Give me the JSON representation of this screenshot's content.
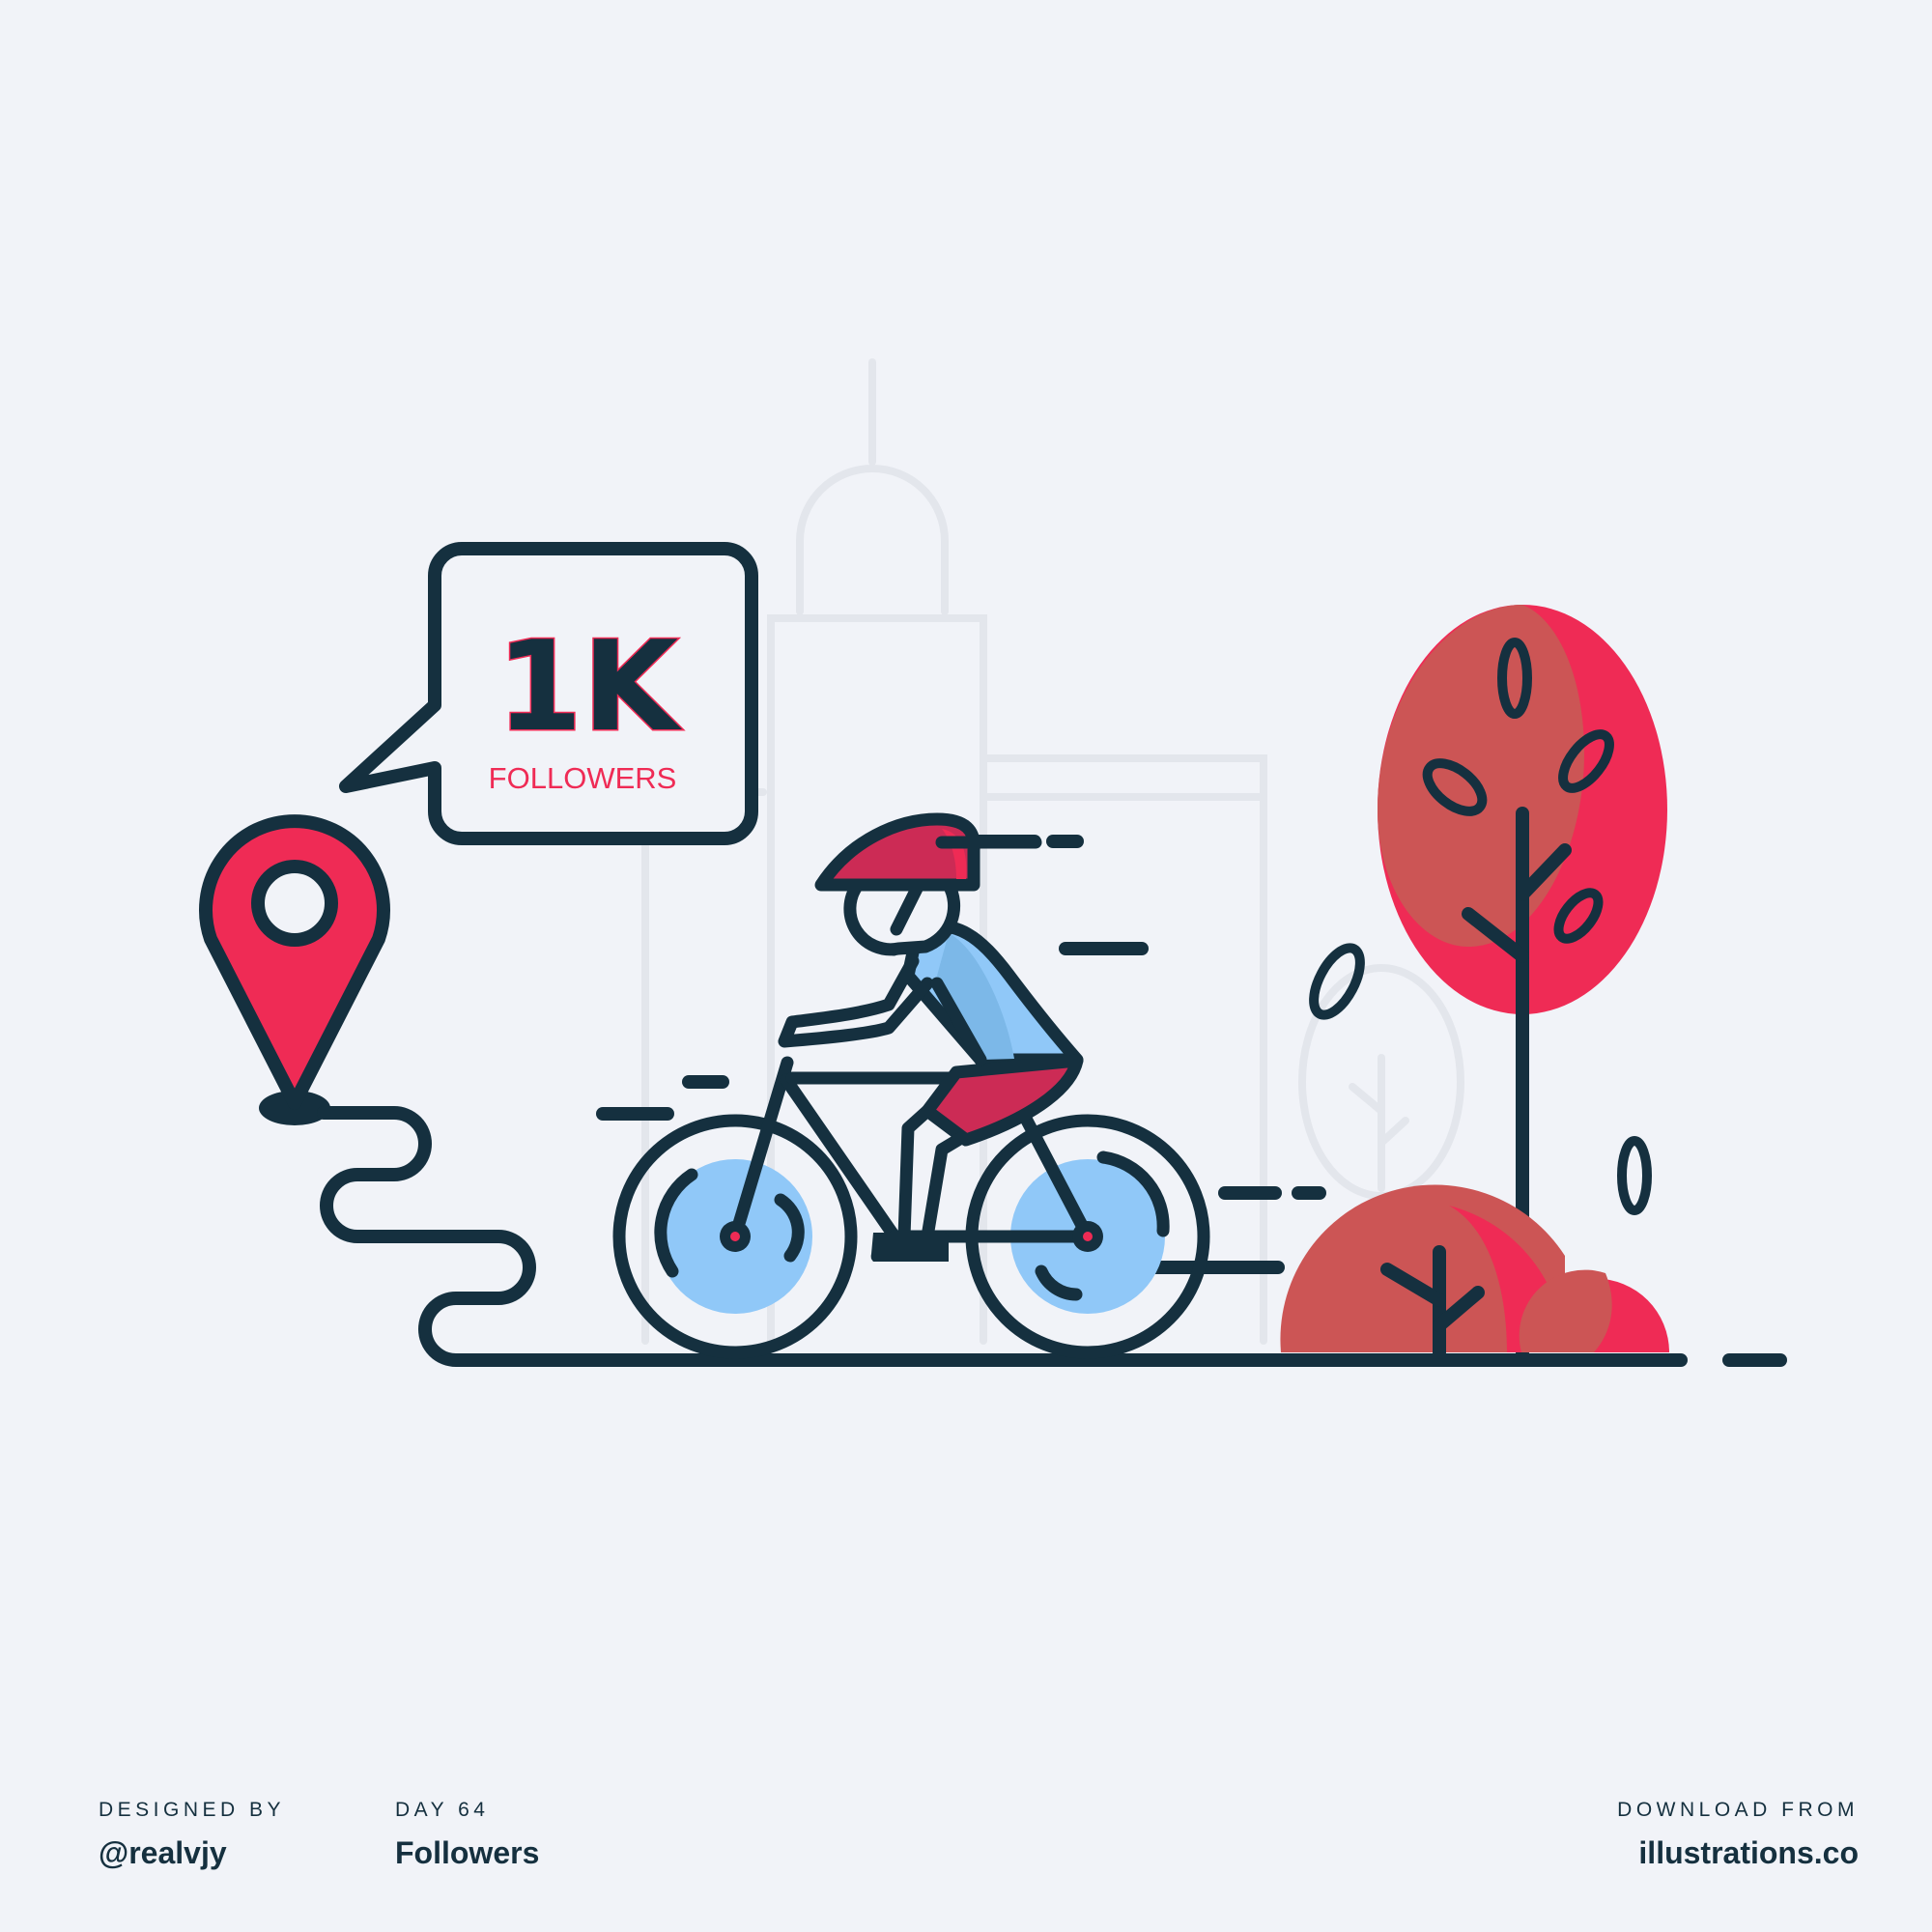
{
  "bubble": {
    "count": "1K",
    "label": "FOLLOWERS"
  },
  "footer": {
    "designed_by_label": "DESIGNED BY",
    "designed_by_value": "@realvjy",
    "day_label": "DAY 64",
    "day_value": "Followers",
    "download_label": "DOWNLOAD FROM",
    "download_value": "illustrations.co"
  },
  "colors": {
    "background": "#f1f3f8",
    "outline": "#15303f",
    "red": "#ef2b55",
    "dark_red": "#cc5555",
    "blue": "#90c8f8",
    "shirt_blue": "#7cb8e8"
  },
  "icons": [
    "map-pin-icon",
    "speech-bubble-icon",
    "bicycle-icon",
    "cyclist-icon",
    "tree-icon",
    "bush-icon"
  ]
}
